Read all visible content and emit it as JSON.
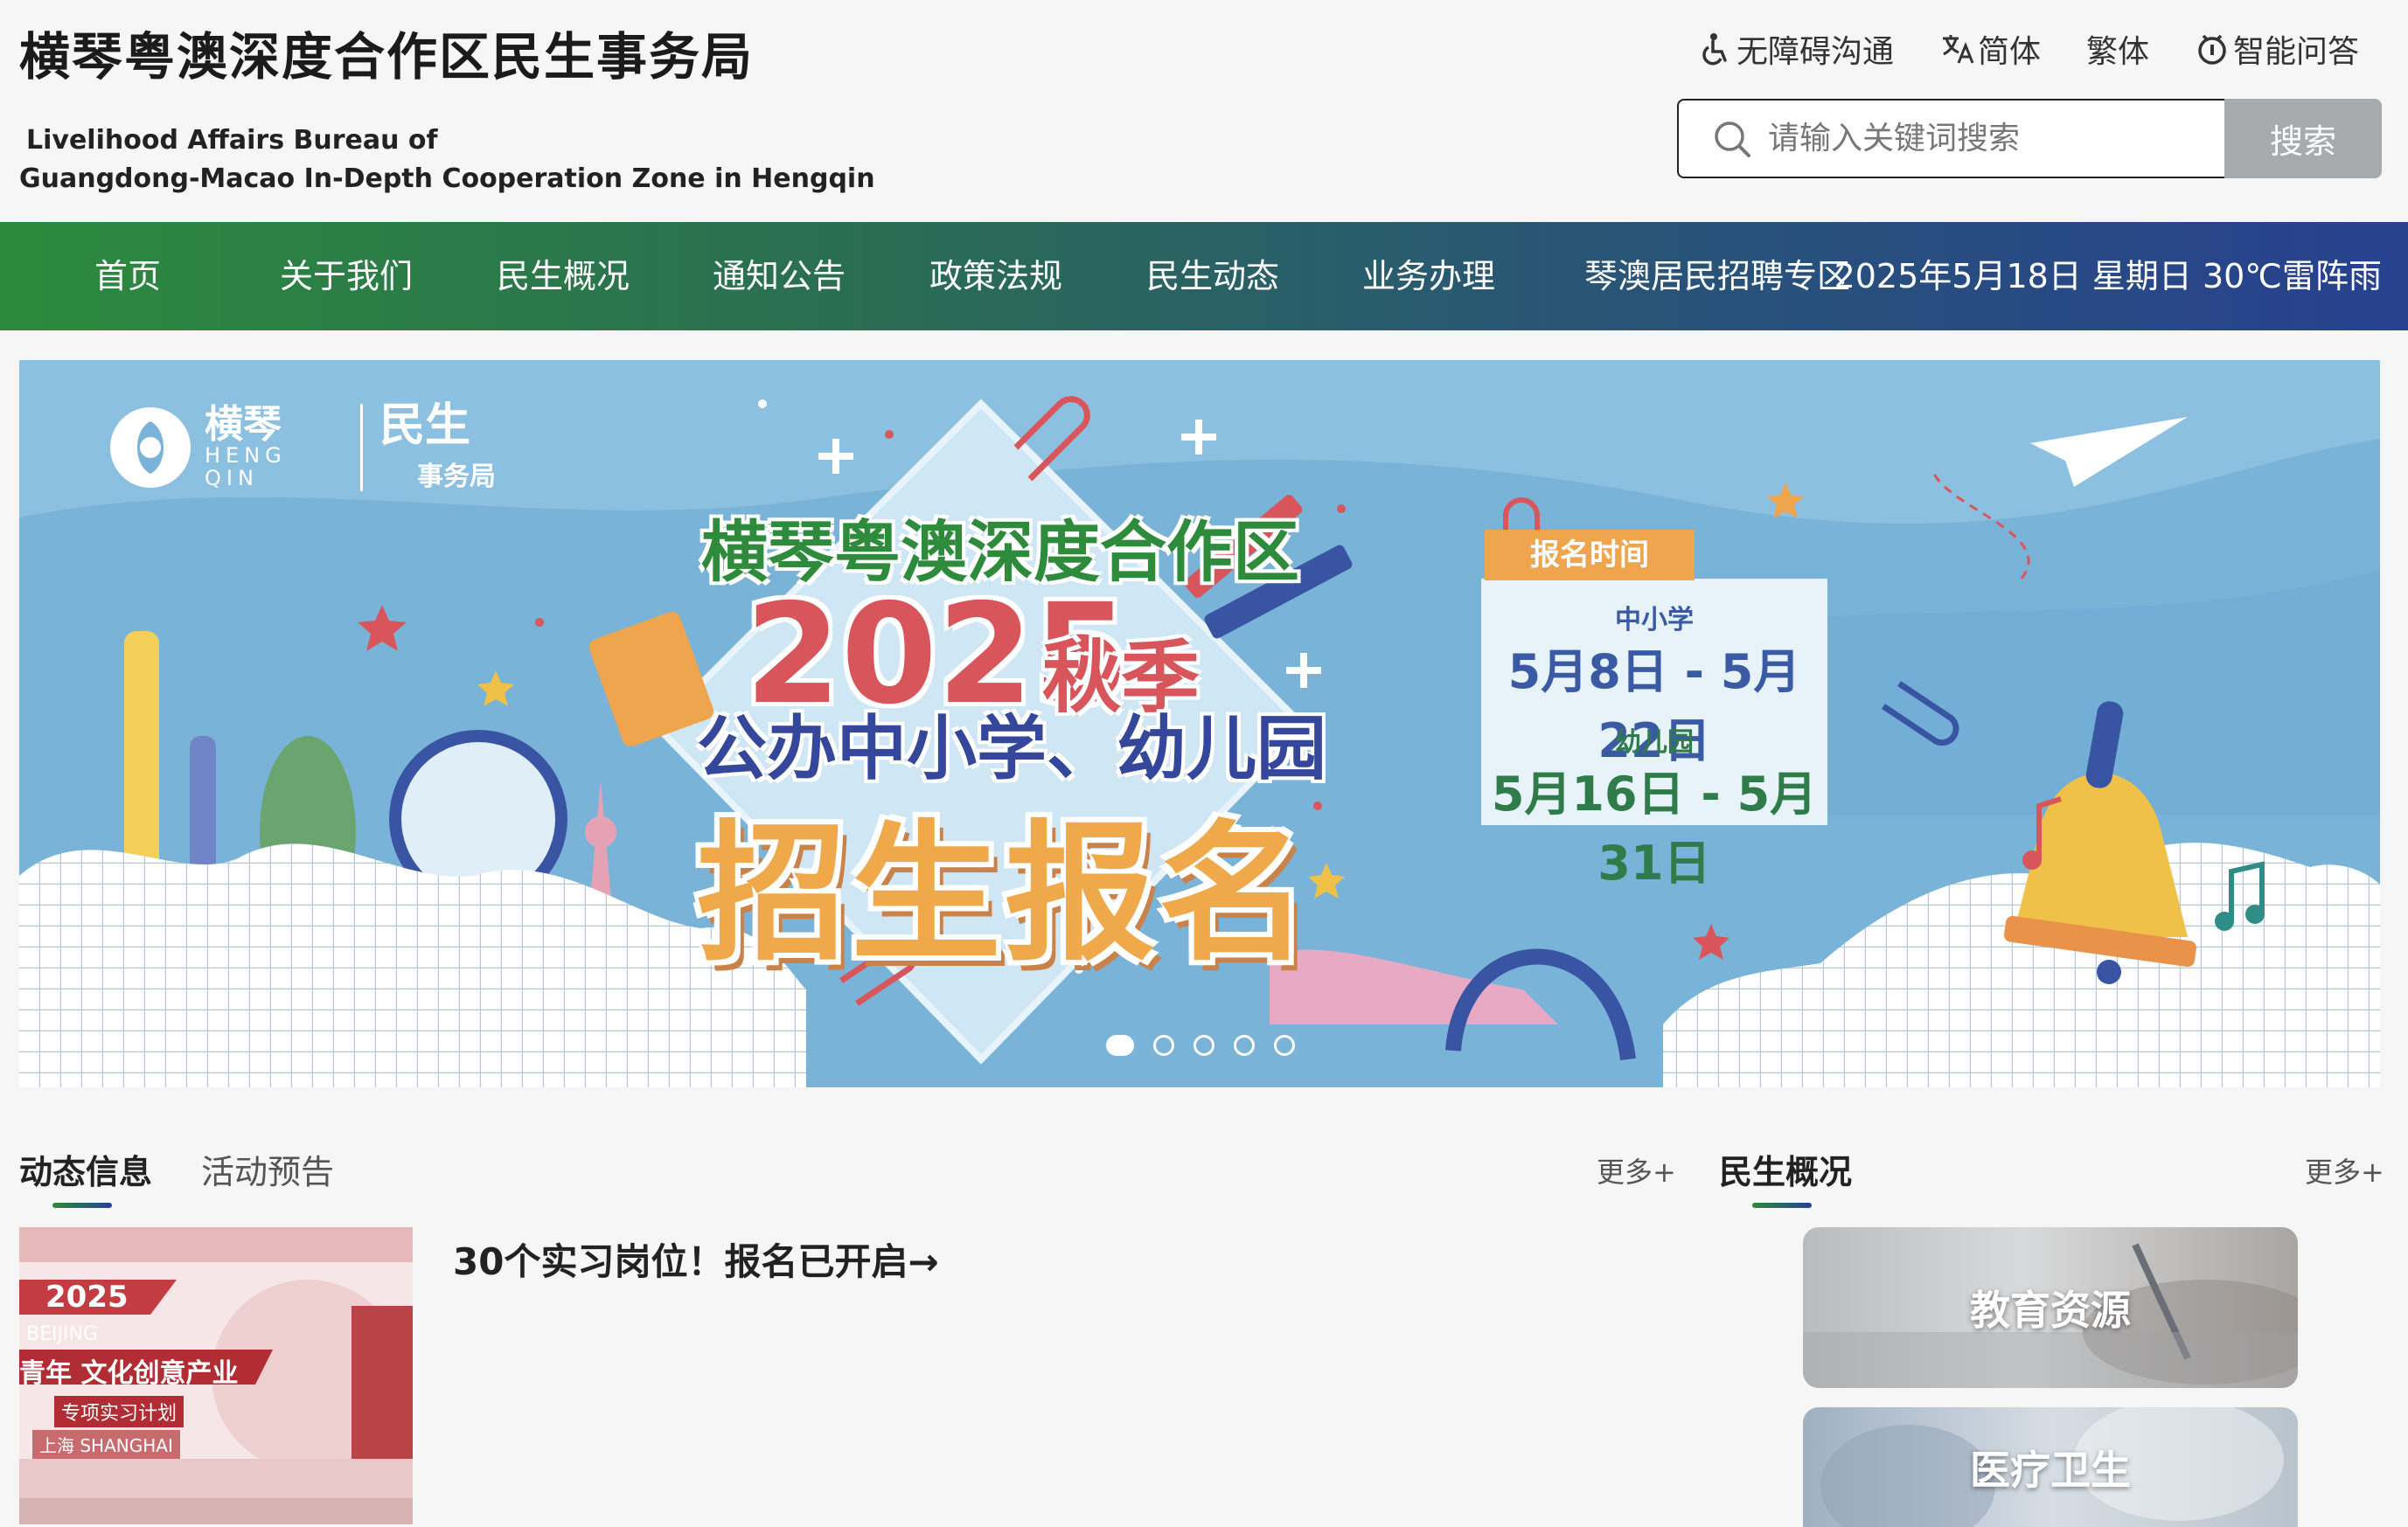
{
  "header": {
    "title_cn": "横琴粤澳深度合作区民生事务局",
    "title_en_line1": "Livelihood Affairs Bureau of",
    "title_en_line2": "Guangdong-Macao In-Depth Cooperation Zone in Hengqin",
    "tools": {
      "accessibility": "无障碍沟通",
      "simplified": "简体",
      "traditional": "繁体",
      "smart_qa": "智能问答"
    },
    "search": {
      "placeholder": "请输入关键词搜索",
      "button": "搜索"
    }
  },
  "nav": {
    "items": [
      "首页",
      "关于我们",
      "民生概况",
      "通知公告",
      "政策法规",
      "民生动态",
      "业务办理",
      "琴澳居民招聘专区"
    ],
    "date_weather": "2025年5月18日 星期日 30℃雷阵雨"
  },
  "banner": {
    "logo_cn": "横琴",
    "logo_en_1": "HENG",
    "logo_en_2": "QIN",
    "logo_bureau_1": "民生",
    "logo_bureau_2": "事务局",
    "headline_1": "横琴粤澳深度合作区",
    "year": "2025",
    "season": "秋季",
    "headline_2": "公办中小学、幼儿园",
    "headline_3": "招生报名",
    "registration": {
      "tag": "报名时间",
      "label_1": "中小学",
      "dates_1": "5月8日 - 5月22日",
      "label_2": "幼儿园",
      "dates_2": "5月16日 - 5月31日"
    },
    "slides_total": 5,
    "active_slide": 1
  },
  "news": {
    "tabs": [
      "动态信息",
      "活动预告"
    ],
    "more": "更多+",
    "headline": "30个实习岗位！报名已开启→",
    "thumb": {
      "year": "2025",
      "city_1": "BEIJING",
      "program": "青年 文化创意产业",
      "subtitle": "专项实习计划",
      "city_2": "上海 SHANGHAI"
    }
  },
  "overview": {
    "title": "民生概况",
    "more": "更多+",
    "cards": [
      "教育资源",
      "医疗卫生"
    ]
  },
  "colors": {
    "nav_start": "#2c8a3d",
    "nav_end": "#27418f",
    "banner_bg": "#7ab3d8",
    "accent_orange": "#efa54e",
    "accent_red": "#d8565b"
  }
}
